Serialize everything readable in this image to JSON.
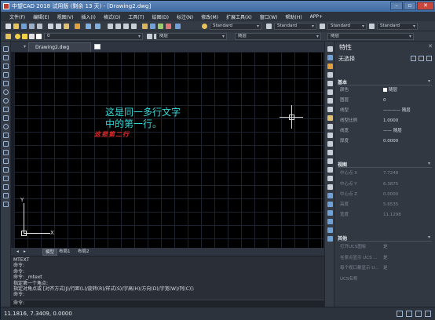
{
  "window": {
    "title": "中望CAD 2018 试用版 (剩余 13 天) - [Drawing2.dwg]",
    "buttons": {
      "minimize": "–",
      "restore": "▫",
      "close": "✕"
    }
  },
  "menu": [
    "文件(F)",
    "编辑(E)",
    "视图(V)",
    "插入(I)",
    "格式(O)",
    "工具(T)",
    "绘图(D)",
    "标注(N)",
    "修改(M)",
    "扩展工具(X)",
    "窗口(W)",
    "帮助(H)",
    "APP+"
  ],
  "toolbar": {
    "text_style": "Standard",
    "dim_style": "Standard",
    "table_style": "Standard",
    "multileader_style": "Standard",
    "layer": "0",
    "color": "随层",
    "linetype": "随层",
    "lineweight": "随层"
  },
  "drawing_tab": {
    "label": "Drawing2.dwg"
  },
  "canvas": {
    "mtext_lines": [
      "这是同一多行文字",
      "中的第一行。"
    ],
    "mtext_red": "这是第二行",
    "ucs_x": "X",
    "ucs_y": "Y"
  },
  "layout_tabs": [
    "模型",
    "布局1",
    "布局2"
  ],
  "command": {
    "history": [
      "MTEXT",
      "命令:",
      "命令:",
      "命令: _mtext",
      "指定第一个角点:",
      "指定对角点或 [对齐方式(J)/行距(L)/旋转(R)/样式(S)/字高(H)/方向(D)/字宽(W)/列(C)]:",
      "命令:"
    ],
    "prompt": "命令:"
  },
  "properties": {
    "title": "特性",
    "selection": "无选择",
    "sections": {
      "basic": "基本",
      "view": "视图",
      "misc": "其他"
    },
    "basic_rows": [
      {
        "label": "颜色",
        "value": "随层"
      },
      {
        "label": "图层",
        "value": "0"
      },
      {
        "label": "线型",
        "value": "———— 随层"
      },
      {
        "label": "线型比例",
        "value": "1.0000"
      },
      {
        "label": "线宽",
        "value": "—— 随层"
      },
      {
        "label": "厚度",
        "value": "0.0000"
      }
    ],
    "view_rows": [
      {
        "label": "中心点 X",
        "value": "7.7248"
      },
      {
        "label": "中心点 Y",
        "value": "6.3875"
      },
      {
        "label": "中心点 Z",
        "value": "0.0000"
      },
      {
        "label": "高度",
        "value": "5.6535"
      },
      {
        "label": "宽度",
        "value": "11.1298"
      }
    ],
    "misc_rows": [
      {
        "label": "打开UCS图标",
        "value": "是"
      },
      {
        "label": "在原点显示 UCS ...",
        "value": "是"
      },
      {
        "label": "每个视口都显示 U...",
        "value": "是"
      },
      {
        "label": "UCS名称",
        "value": ""
      }
    ]
  },
  "status": {
    "coords": "11.1816, 7.3409, 0.0000"
  }
}
